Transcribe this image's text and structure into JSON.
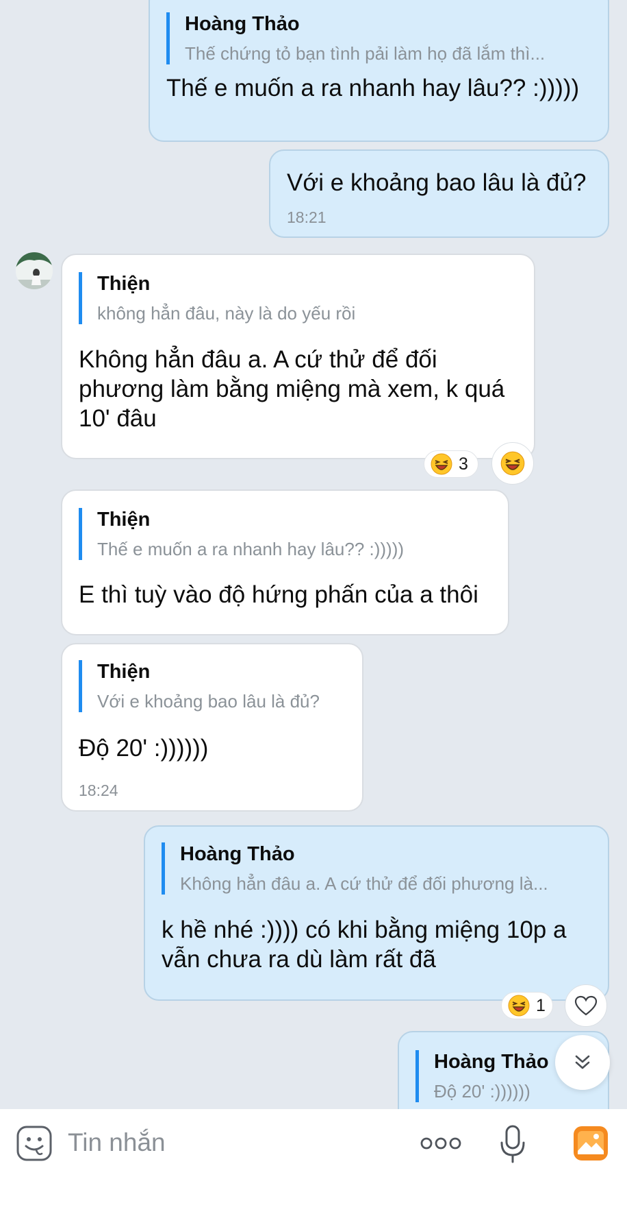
{
  "messages": [
    {
      "quote_name": "Hoàng Thảo",
      "quote_text": "Thế chứng tỏ bạn tình pải làm họ đã lắm thì...",
      "text": "Thế e muốn a ra nhanh hay lâu?? :)))))"
    },
    {
      "text": "Với e khoảng bao lâu là đủ?",
      "time": "18:21"
    },
    {
      "quote_name": "Thiện",
      "quote_text": "không hẳn đâu, này là do yếu rồi",
      "text": "Không hẳn đâu a. A cứ thử để đối phương làm bằng miệng mà xem, k quá 10' đâu",
      "reaction_count": "3"
    },
    {
      "quote_name": "Thiện",
      "quote_text": "Thế e muốn a ra nhanh hay lâu?? :)))))",
      "text": "E thì tuỳ vào độ hứng phấn của a thôi"
    },
    {
      "quote_name": "Thiện",
      "quote_text": "Với e khoảng bao lâu là đủ?",
      "text": "Độ 20' :))))))",
      "time": "18:24"
    },
    {
      "quote_name": "Hoàng Thảo",
      "quote_text": "Không hẳn đâu a. A cứ thử để đối phương là...",
      "text": "k hề nhé :)))) có khi bằng miệng 10p a vẫn chưa ra dù làm rất đã",
      "reaction_count": "1"
    },
    {
      "quote_name": "Hoàng Thảo",
      "quote_text": "Độ 20' :))))))"
    }
  ],
  "input": {
    "placeholder": "Tin nhắn"
  },
  "colors": {
    "background": "#e4e9ef",
    "outgoing_bubble": "#d7ecfb",
    "incoming_bubble": "#ffffff",
    "quote_bar": "#1f8cf0",
    "gallery_icon": "#f58a1f"
  },
  "icons": {
    "reaction": "laughing-emoji-icon",
    "heart": "heart-icon",
    "scroll": "chevron-double-down-icon",
    "sticker": "sticker-icon",
    "more": "more-dots-icon",
    "mic": "microphone-icon",
    "gallery": "gallery-icon"
  }
}
